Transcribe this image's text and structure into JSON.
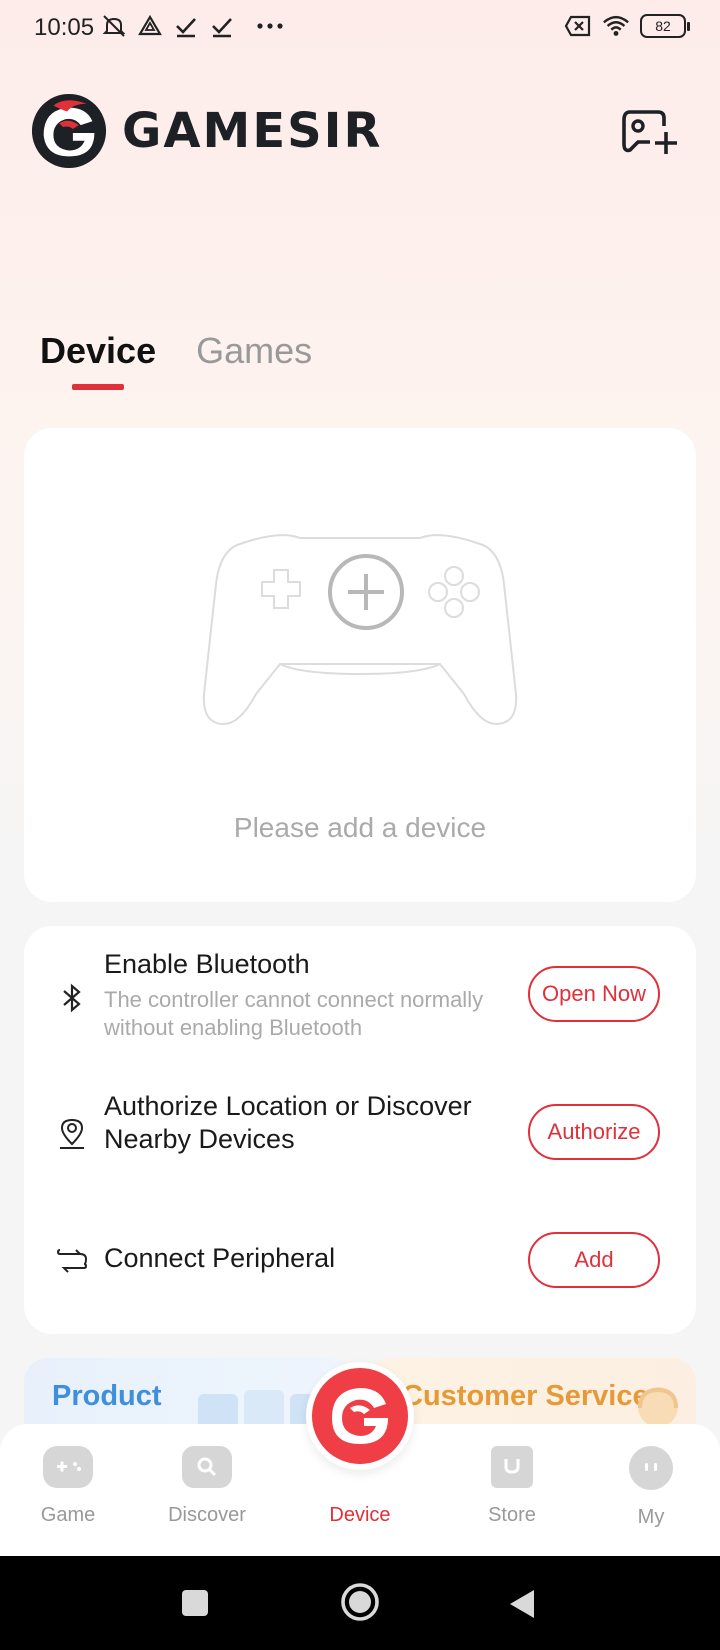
{
  "status_bar": {
    "time": "10:05",
    "battery": "82",
    "icons": [
      "mute-icon",
      "drive-icon",
      "check-icon",
      "check-icon",
      "more-dots-icon",
      "no-sim-icon",
      "wifi-icon",
      "battery-icon"
    ]
  },
  "header": {
    "brand": "GAMESIR",
    "brand_colors": {
      "red": "#e0303a",
      "dark": "#1d2024"
    }
  },
  "tabs": [
    {
      "label": "Device",
      "active": true
    },
    {
      "label": "Games",
      "active": false
    }
  ],
  "device_card": {
    "empty_text": "Please add a device"
  },
  "setup": {
    "bluetooth": {
      "title": "Enable Bluetooth",
      "desc": "The controller cannot connect normally without enabling Bluetooth",
      "button": "Open Now"
    },
    "location": {
      "title": "Authorize Location or Discover Nearby Devices",
      "button": "Authorize"
    },
    "peripheral": {
      "title": "Connect Peripheral",
      "button": "Add"
    }
  },
  "promo": {
    "product": "Product",
    "service": "Customer Service"
  },
  "bottom_nav": [
    {
      "label": "Game",
      "icon": "gamepad-icon",
      "active": false
    },
    {
      "label": "Discover",
      "icon": "discover-icon",
      "active": false
    },
    {
      "label": "Device",
      "icon": "gamesir-logo-icon",
      "active": true
    },
    {
      "label": "Store",
      "icon": "store-bag-icon",
      "active": false
    },
    {
      "label": "My",
      "icon": "profile-face-icon",
      "active": false
    }
  ],
  "colors": {
    "accent": "#e0303a",
    "product_blue": "#3f8fdc",
    "service_orange": "#e69a37"
  }
}
